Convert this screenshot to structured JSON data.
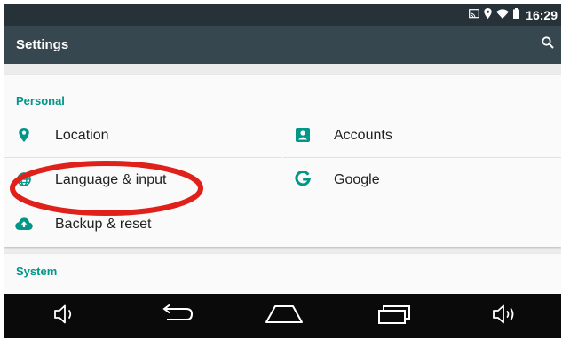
{
  "status_bar": {
    "time": "16:29",
    "icons": [
      "cast-icon",
      "location-icon",
      "wifi-icon",
      "battery-icon"
    ]
  },
  "app_bar": {
    "title": "Settings",
    "search_icon": "search-icon"
  },
  "sections": {
    "personal": {
      "header": "Personal",
      "items": [
        {
          "label": "Location",
          "icon": "location-pin-icon"
        },
        {
          "label": "Accounts",
          "icon": "account-box-icon"
        },
        {
          "label": "Language & input",
          "icon": "globe-icon"
        },
        {
          "label": "Google",
          "icon": "google-g-icon"
        },
        {
          "label": "Backup & reset",
          "icon": "cloud-upload-icon"
        }
      ]
    },
    "system": {
      "header": "System"
    }
  },
  "nav_bar": {
    "buttons": [
      "volume-down-icon",
      "back-icon",
      "home-icon",
      "recents-icon",
      "volume-up-icon"
    ]
  },
  "colors": {
    "status_bar": "#263238",
    "app_bar": "#37474f",
    "accent": "#009688",
    "annotation": "#e0201a",
    "nav_bar": "#0a0a0a"
  }
}
